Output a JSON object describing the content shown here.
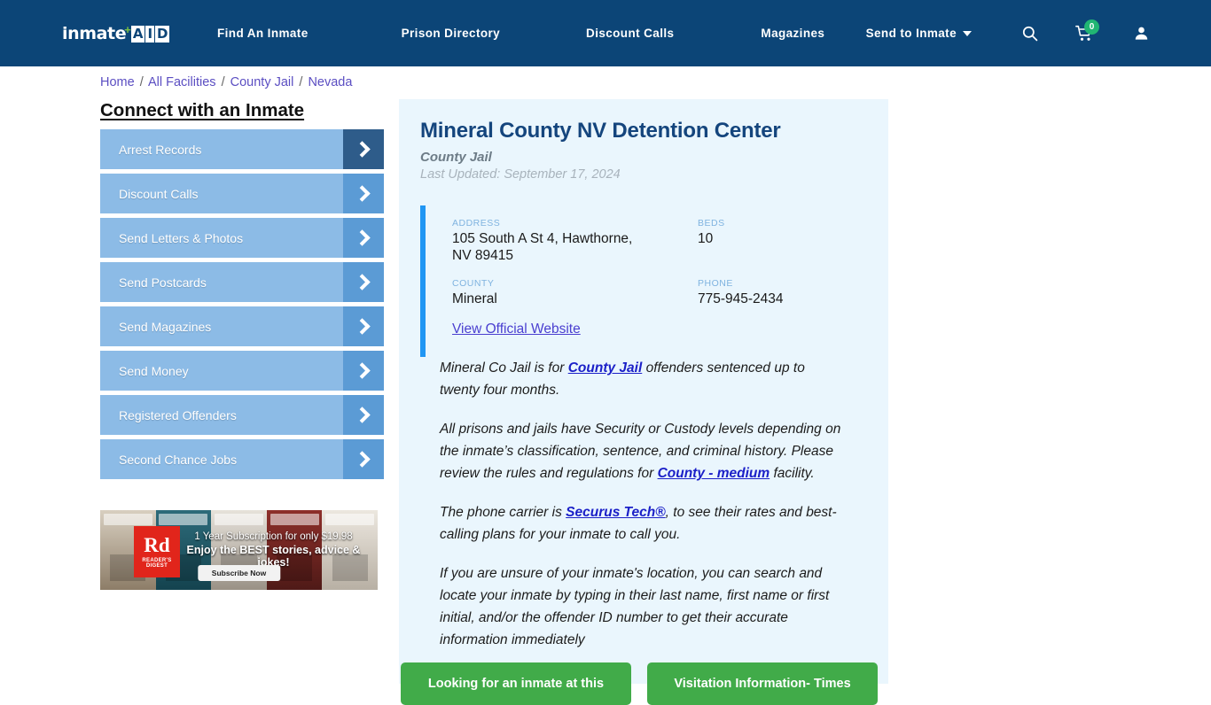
{
  "header": {
    "logo": {
      "word": "inmate",
      "plus": "+",
      "aid": [
        "A",
        "I",
        "D"
      ]
    },
    "nav": [
      {
        "label": "Find An Inmate",
        "name": "nav-find-an-inmate"
      },
      {
        "label": "Prison Directory",
        "name": "nav-prison-directory"
      },
      {
        "label": "Discount Calls",
        "name": "nav-discount-calls"
      },
      {
        "label": "Magazines",
        "name": "nav-magazines"
      }
    ],
    "send_to_inmate": "Send to Inmate",
    "cart_count": "0",
    "icons": [
      "search-icon",
      "cart-icon",
      "user-account-icon"
    ],
    "bg_color": "#0c4577"
  },
  "breadcrumb": {
    "items": [
      "Home",
      "All Facilities",
      "County Jail",
      "Nevada"
    ],
    "separator": "/"
  },
  "sidebar": {
    "title": "Connect with an Inmate",
    "items": [
      {
        "label": "Arrest Records",
        "active": true
      },
      {
        "label": "Discount Calls",
        "active": false
      },
      {
        "label": "Send Letters & Photos",
        "active": false
      },
      {
        "label": "Send Postcards",
        "active": false
      },
      {
        "label": "Send Magazines",
        "active": false
      },
      {
        "label": "Send Money",
        "active": false
      },
      {
        "label": "Registered Offenders",
        "active": false
      },
      {
        "label": "Second Chance Jobs",
        "active": false
      }
    ]
  },
  "ad": {
    "brand_initials": "Rd",
    "brand_name": "READER'S DIGEST",
    "line1": "1 Year Subscription for only $19.98",
    "line2": "Enjoy the BEST stories, advice & jokes!",
    "button": "Subscribe Now"
  },
  "facility": {
    "name": "Mineral County NV Detention Center",
    "type": "County Jail",
    "last_updated": "Last Updated: September 17, 2024",
    "info": {
      "address_label": "ADDRESS",
      "address_value": "105 South A St 4, Hawthorne, NV 89415",
      "beds_label": "BEDS",
      "beds_value": "10",
      "county_label": "COUNTY",
      "county_value": "Mineral",
      "phone_label": "PHONE",
      "phone_value": "775-945-2434",
      "website_link": "View Official Website"
    },
    "paragraphs": [
      {
        "parts": [
          {
            "t": "Mineral Co Jail is for ",
            "link": false
          },
          {
            "t": "County Jail",
            "link": true
          },
          {
            "t": " offenders sentenced up to twenty four months.",
            "link": false
          }
        ]
      },
      {
        "parts": [
          {
            "t": "All prisons and jails have Security or Custody levels depending on the inmate’s classification, sentence, and criminal history. Please review the rules and regulations for ",
            "link": false
          },
          {
            "t": "County - medium",
            "link": true
          },
          {
            "t": " facility.",
            "link": false
          }
        ]
      },
      {
        "parts": [
          {
            "t": "The phone carrier is ",
            "link": false
          },
          {
            "t": "Securus Tech®",
            "link": true
          },
          {
            "t": ", to see their rates and best-calling plans for your inmate to call you.",
            "link": false
          }
        ]
      },
      {
        "parts": [
          {
            "t": "If you are unsure of your inmate's location, you can search and locate your inmate by typing in their last name, first name or first initial, and/or the offender ID number to get their accurate information immediately",
            "link": false
          }
        ]
      }
    ],
    "registered_offenders_link": "Registered Offenders"
  },
  "cta": {
    "buttons": [
      "Looking for an inmate at this",
      "Visitation Information- Times"
    ],
    "color": "#41ab49"
  }
}
